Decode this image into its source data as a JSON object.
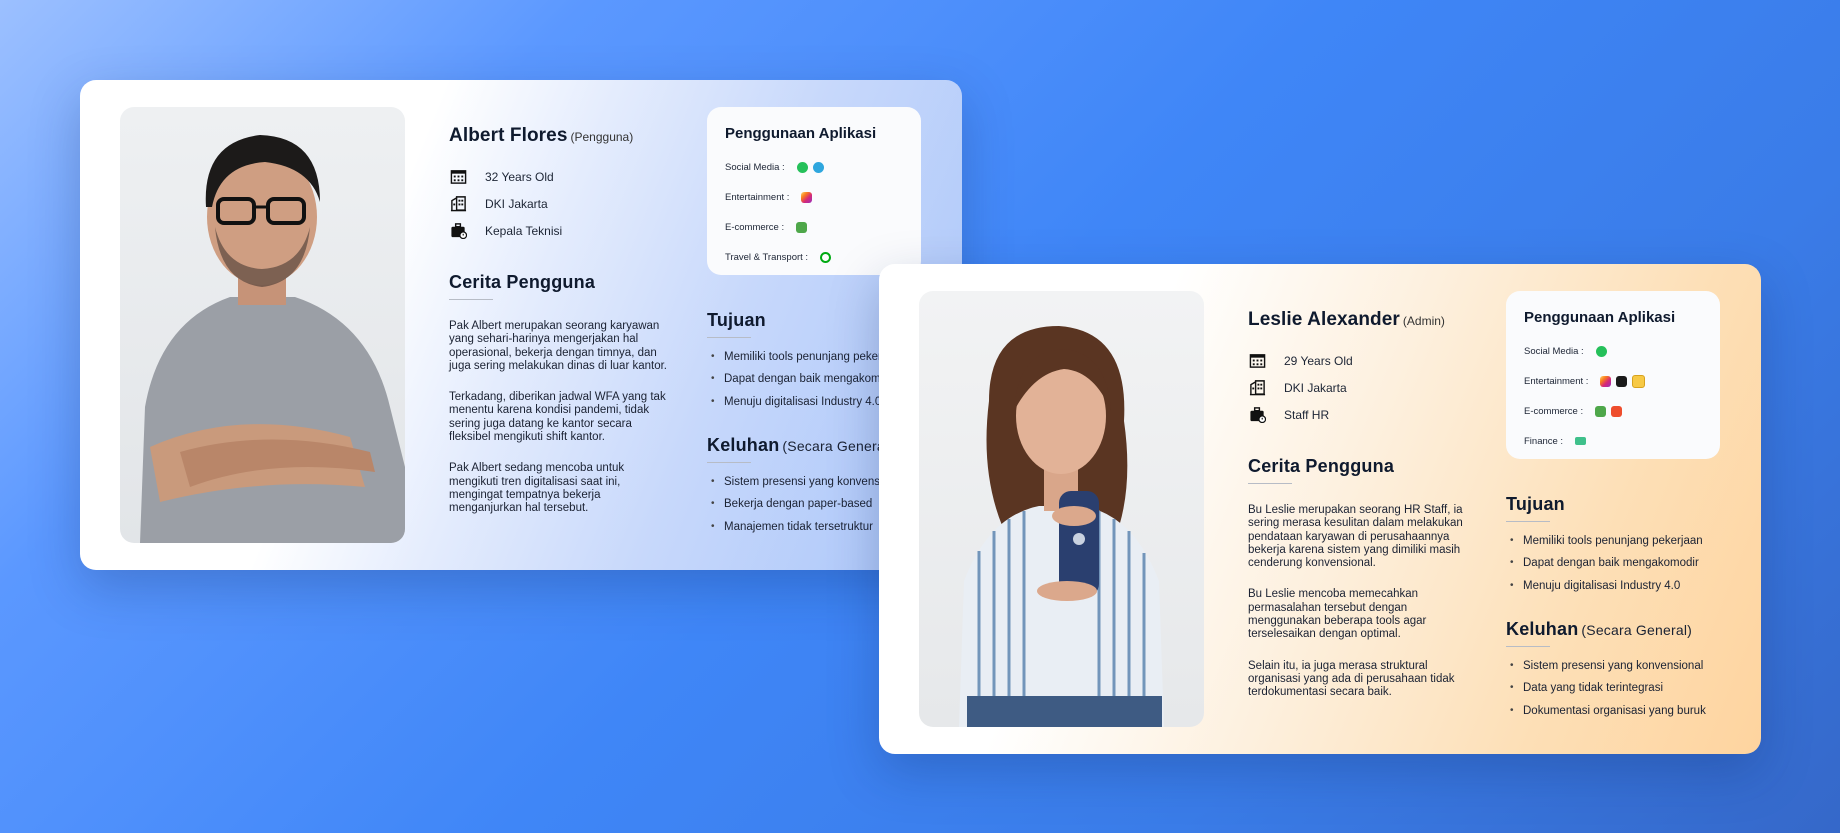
{
  "personas": [
    {
      "name": "Albert Flores",
      "role": "(Pengguna)",
      "info": [
        {
          "icon": "calendar-icon",
          "text": "32 Years Old"
        },
        {
          "icon": "building-icon",
          "text": "DKI Jakarta"
        },
        {
          "icon": "briefcase-icon",
          "text": "Kepala Teknisi"
        }
      ],
      "story_title": "Cerita Pengguna",
      "story": [
        "Pak Albert merupakan seorang karyawan yang sehari-harinya mengerjakan hal operasional, bekerja dengan timnya, dan juga sering melakukan dinas di luar kantor.",
        "Terkadang, diberikan jadwal WFA yang tak menentu karena kondisi pandemi, tidak sering juga datang ke kantor secara fleksibel mengikuti shift kantor.",
        "Pak Albert sedang mencoba untuk mengikuti tren digitalisasi saat ini, mengingat tempatnya bekerja menganjurkan hal tersebut."
      ],
      "app_usage": {
        "title": "Penggunaan Aplikasi",
        "rows": [
          {
            "label": "Social Media :",
            "icons": [
              "whatsapp-icon",
              "telegram-icon"
            ]
          },
          {
            "label": "Entertainment :",
            "icons": [
              "instagram-icon"
            ]
          },
          {
            "label": "E-commerce :",
            "icons": [
              "tokopedia-icon"
            ]
          },
          {
            "label": "Travel & Transport :",
            "icons": [
              "gojek-icon"
            ]
          }
        ]
      },
      "goals_title": "Tujuan",
      "goals": [
        "Memiliki tools penunjang pekerjaan",
        "Dapat dengan baik mengakomodir",
        "Menuju digitalisasi Industry 4.0"
      ],
      "complaints_title": "Keluhan",
      "complaints_subtitle": "(Secara General)",
      "complaints": [
        "Sistem presensi yang konvensional",
        "Bekerja dengan paper-based",
        "Manajemen tidak tersetruktur"
      ]
    },
    {
      "name": "Leslie Alexander",
      "role": "(Admin)",
      "info": [
        {
          "icon": "calendar-icon",
          "text": "29 Years Old"
        },
        {
          "icon": "building-icon",
          "text": "DKI Jakarta"
        },
        {
          "icon": "briefcase-icon",
          "text": "Staff HR"
        }
      ],
      "story_title": "Cerita Pengguna",
      "story": [
        "Bu Leslie merupakan seorang HR Staff, ia sering merasa kesulitan dalam melakukan pendataan karyawan di perusahaannya bekerja karena sistem yang dimiliki masih cenderung konvensional.",
        "Bu Leslie mencoba memecahkan permasalahan tersebut dengan menggunakan beberapa tools agar terselesaikan dengan optimal.",
        "Selain itu, ia juga merasa struktural organisasi yang ada di perusahaan tidak terdokumentasi secara baik."
      ],
      "app_usage": {
        "title": "Penggunaan Aplikasi",
        "rows": [
          {
            "label": "Social Media :",
            "icons": [
              "whatsapp-icon"
            ]
          },
          {
            "label": "Entertainment :",
            "icons": [
              "instagram-icon",
              "netflix-icon",
              "notion-icon"
            ]
          },
          {
            "label": "E-commerce :",
            "icons": [
              "tokopedia-icon",
              "shopee-icon"
            ]
          },
          {
            "label": "Finance :",
            "icons": [
              "finance-app-icon"
            ]
          }
        ]
      },
      "goals_title": "Tujuan",
      "goals": [
        "Memiliki tools penunjang pekerjaan",
        "Dapat dengan baik mengakomodir",
        "Menuju digitalisasi Industry 4.0"
      ],
      "complaints_title": "Keluhan",
      "complaints_subtitle": "(Secara General)",
      "complaints": [
        "Sistem presensi yang konvensional",
        "Data yang tidak terintegrasi",
        "Dokumentasi organisasi yang buruk"
      ]
    }
  ]
}
